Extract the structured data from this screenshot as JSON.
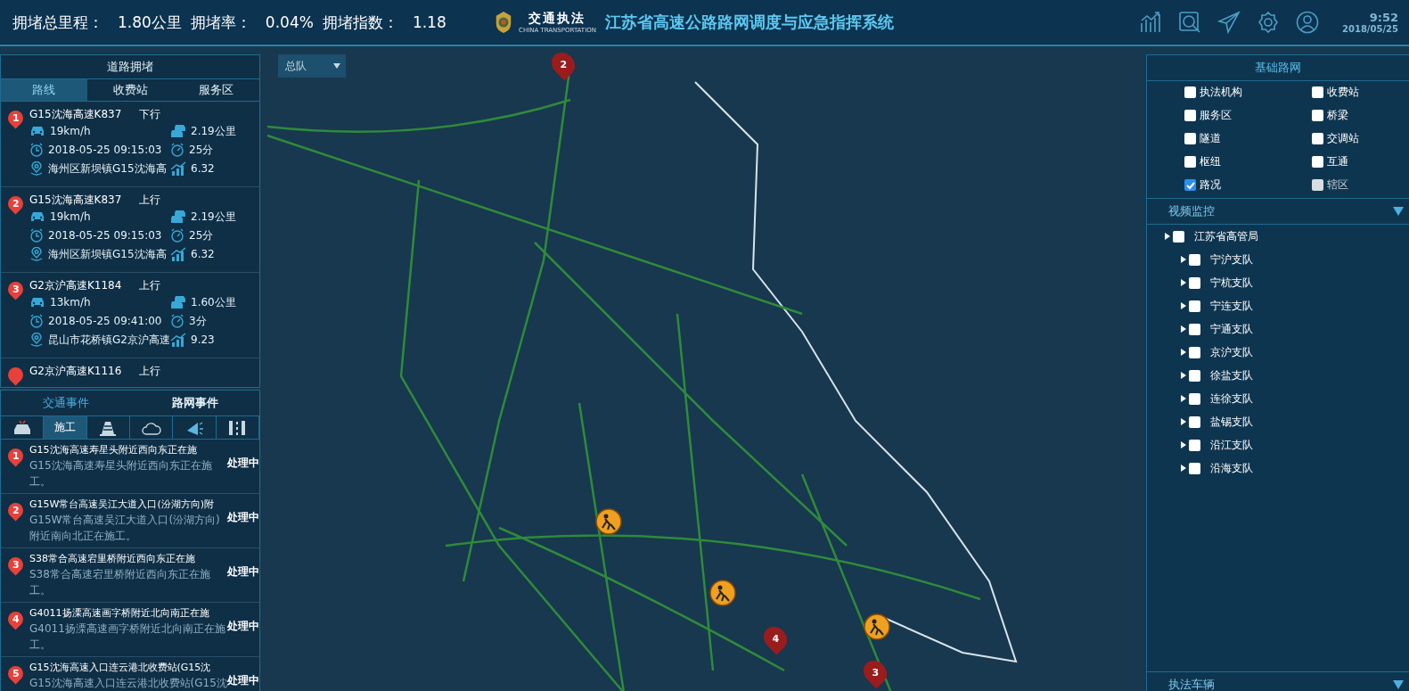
{
  "header": {
    "stats": [
      {
        "label": "拥堵总里程：",
        "value": "1.80公里"
      },
      {
        "label": "拥堵率：",
        "value": "0.04%"
      },
      {
        "label": "拥堵指数：",
        "value": "1.18"
      }
    ],
    "logo": {
      "name": "交通执法",
      "subtitle": "CHINA TRANSPORTATION"
    },
    "title": "江苏省高速公路路网调度与应急指挥系统",
    "time": "9:52",
    "date": "2018/05/25"
  },
  "dropdown": {
    "value": "总队"
  },
  "congestion": {
    "title": "道路拥堵",
    "tabs": [
      {
        "label": "路线",
        "selected": true
      },
      {
        "label": "收费站",
        "selected": false
      },
      {
        "label": "服务区",
        "selected": false
      }
    ],
    "items": [
      {
        "number": "1",
        "road": "G15沈海高速K837",
        "direction": "下行",
        "speed": "19km/h",
        "length": "2.19公里",
        "time": "2018-05-25 09:15:03",
        "duration": "25分",
        "location": "海州区新坝镇G15沈海高",
        "index": "6.32"
      },
      {
        "number": "2",
        "road": "G15沈海高速K837",
        "direction": "上行",
        "speed": "19km/h",
        "length": "2.19公里",
        "time": "2018-05-25 09:15:03",
        "duration": "25分",
        "location": "海州区新坝镇G15沈海高",
        "index": "6.32"
      },
      {
        "number": "3",
        "road": "G2京沪高速K1184",
        "direction": "上行",
        "speed": "13km/h",
        "length": "1.60公里",
        "time": "2018-05-25 09:41:00",
        "duration": "3分",
        "location": "昆山市花桥镇G2京沪高速",
        "index": "9.23"
      },
      {
        "road": "G2京沪高速K1116",
        "direction": "上行"
      }
    ]
  },
  "events": {
    "tabs": [
      {
        "label": "交通事件",
        "selected": true
      },
      {
        "label": "路网事件",
        "selected": false
      }
    ],
    "categories": [
      {
        "kind": "accident",
        "selected": false
      },
      {
        "kind": "text",
        "label": "施工",
        "selected": true
      },
      {
        "kind": "cone",
        "selected": false
      },
      {
        "kind": "weather",
        "selected": false
      },
      {
        "kind": "announcement",
        "selected": false
      },
      {
        "kind": "road",
        "selected": false
      }
    ],
    "items": [
      {
        "number": "1",
        "title": "G15沈海高速寿星头附近西向东正在施",
        "description": "G15沈海高速寿星头附近西向东正在施工。",
        "status": "处理中"
      },
      {
        "number": "2",
        "title": "G15W常台高速吴江大道入口(汾湖方向)附",
        "description": "G15W常台高速吴江大道入口(汾湖方向)附近南向北正在施工。",
        "status": "处理中"
      },
      {
        "number": "3",
        "title": "S38常合高速宕里桥附近西向东正在施",
        "description": "S38常合高速宕里桥附近西向东正在施工。",
        "status": "处理中"
      },
      {
        "number": "4",
        "title": "G4011扬溧高速画字桥附近北向南正在施",
        "description": "G4011扬溧高速画字桥附近北向南正在施工。",
        "status": "处理中"
      },
      {
        "number": "5",
        "title": "G15沈海高速入口连云港北收费站(G15沈",
        "description": "G15沈海高速入口连云港北收费站(G15沈",
        "status": "处理中"
      }
    ]
  },
  "layers": {
    "title": "基础路网",
    "items": [
      {
        "label": "执法机构",
        "checked": false,
        "disabled": false
      },
      {
        "label": "收费站",
        "checked": false,
        "disabled": false
      },
      {
        "label": "服务区",
        "checked": false,
        "disabled": false
      },
      {
        "label": "桥梁",
        "checked": false,
        "disabled": false
      },
      {
        "label": "隧道",
        "checked": false,
        "disabled": false
      },
      {
        "label": "交调站",
        "checked": false,
        "disabled": false
      },
      {
        "label": "枢纽",
        "checked": false,
        "disabled": false
      },
      {
        "label": "互通",
        "checked": false,
        "disabled": false
      },
      {
        "label": "路况",
        "checked": true,
        "disabled": false
      },
      {
        "label": "辖区",
        "checked": false,
        "disabled": true
      }
    ]
  },
  "video": {
    "title": "视频监控",
    "tree": [
      {
        "label": "江苏省高管局",
        "checked": false,
        "children": [
          {
            "label": "宁沪支队",
            "checked": false
          },
          {
            "label": "宁杭支队",
            "checked": false
          },
          {
            "label": "宁连支队",
            "checked": false
          },
          {
            "label": "宁通支队",
            "checked": false
          },
          {
            "label": "京沪支队",
            "checked": false
          },
          {
            "label": "徐盐支队",
            "checked": false
          },
          {
            "label": "连徐支队",
            "checked": false
          },
          {
            "label": "盐锡支队",
            "checked": false
          },
          {
            "label": "沿江支队",
            "checked": false
          },
          {
            "label": "沿海支队",
            "checked": false
          }
        ]
      }
    ]
  },
  "vehicles": {
    "title": "执法车辆"
  },
  "map": {
    "markers": [
      {
        "kind": "numbered",
        "label": "2"
      },
      {
        "kind": "numbered",
        "label": "4"
      },
      {
        "kind": "numbered",
        "label": "3"
      },
      {
        "kind": "construction"
      },
      {
        "kind": "construction"
      },
      {
        "kind": "construction"
      }
    ]
  }
}
